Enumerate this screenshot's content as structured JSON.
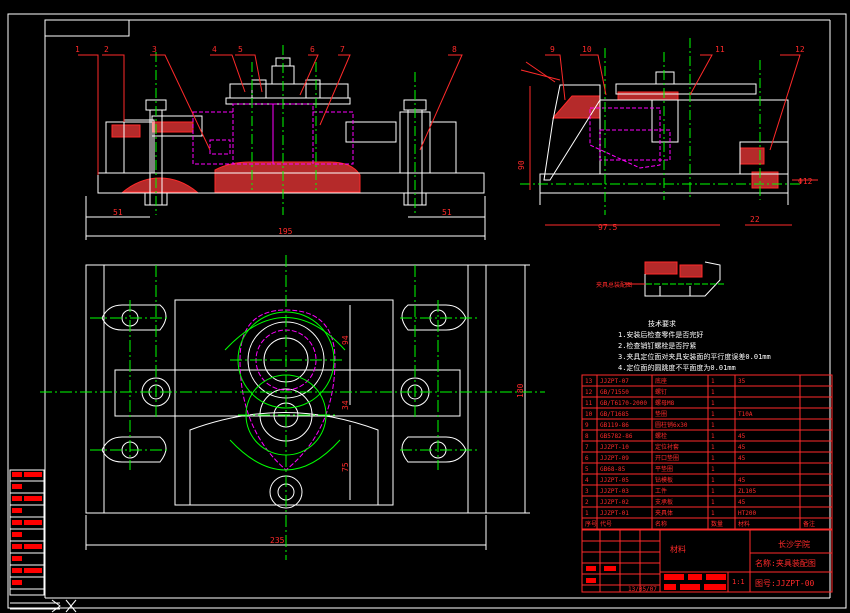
{
  "colors": {
    "background": "#000000",
    "outline": "#ffffff",
    "annotation": "#ff0000",
    "centerline": "#00ff00",
    "workpiece": "#ff00ff",
    "dimension_text": "#ff2a2a",
    "hatch": "#ff2a2a",
    "bom_header_text": "#ffffff"
  },
  "drawing": {
    "front_view_numbers": [
      "1",
      "2",
      "3",
      "4",
      "5",
      "6",
      "7",
      "8"
    ],
    "side_view_numbers": [
      "9",
      "10",
      "11",
      "12"
    ],
    "front_dims": {
      "left": "51",
      "right": "51",
      "overall": "195"
    },
    "side_dims": {
      "height": "90",
      "width": "97.5",
      "right": "22",
      "hole": "Φ12"
    },
    "plan_dims": {
      "a": "94",
      "b": "34",
      "c": "75",
      "height": "180",
      "overall": "235"
    },
    "detail_label": "夹具总装配图"
  },
  "tech_requirements": {
    "title": "技术要求",
    "items": [
      "1.安装后检查零件是否完好",
      "2.检查销钉螺栓是否拧紧",
      "3.夹具定位面对夹具安装面的平行度误差0.01mm",
      "4.定位面的圆跳度不平面度为0.01mm"
    ]
  },
  "bom": {
    "rows": [
      {
        "no": "13",
        "code": "JJZPT-07",
        "name": "底座",
        "qty": "1",
        "mat": "35",
        "note": ""
      },
      {
        "no": "12",
        "code": "GB/71550",
        "name": "螺钉",
        "qty": "1",
        "mat": "",
        "note": ""
      },
      {
        "no": "11",
        "code": "GB/T6170-2000",
        "name": "螺母M8",
        "qty": "1",
        "mat": "",
        "note": ""
      },
      {
        "no": "10",
        "code": "GB/T1685",
        "name": "垫圈",
        "qty": "1",
        "mat": "T10A",
        "note": ""
      },
      {
        "no": "9",
        "code": "GB119-86",
        "name": "圆柱销6x30",
        "qty": "1",
        "mat": "",
        "note": ""
      },
      {
        "no": "8",
        "code": "GB5782-86",
        "name": "螺栓",
        "qty": "1",
        "mat": "45",
        "note": ""
      },
      {
        "no": "7",
        "code": "JJZPT-10",
        "name": "定位衬套",
        "qty": "1",
        "mat": "45",
        "note": ""
      },
      {
        "no": "6",
        "code": "JJZPT-09",
        "name": "开口垫圈",
        "qty": "1",
        "mat": "45",
        "note": ""
      },
      {
        "no": "5",
        "code": "GB68-85",
        "name": "平垫圈",
        "qty": "1",
        "mat": "",
        "note": ""
      },
      {
        "no": "4",
        "code": "JJZPT-05",
        "name": "钻模板",
        "qty": "1",
        "mat": "45",
        "note": ""
      },
      {
        "no": "3",
        "code": "JJZPT-03",
        "name": "工件",
        "qty": "1",
        "mat": "ZL105",
        "note": ""
      },
      {
        "no": "2",
        "code": "JJZPT-02",
        "name": "支承板",
        "qty": "1",
        "mat": "45",
        "note": ""
      },
      {
        "no": "1",
        "code": "JJZPT-01",
        "name": "夹具体",
        "qty": "1",
        "mat": "HT200",
        "note": ""
      }
    ],
    "header": {
      "no": "序号",
      "code": "代号",
      "name": "名称",
      "qty": "数量",
      "mat": "材料",
      "note": "备注"
    }
  },
  "title_block": {
    "school": "长沙学院",
    "material_label": "材料",
    "name_label": "名称:夹具装配图",
    "drawing_no": "图号:JJZPT-00",
    "scale": "1:1",
    "date": "13/05/07"
  }
}
